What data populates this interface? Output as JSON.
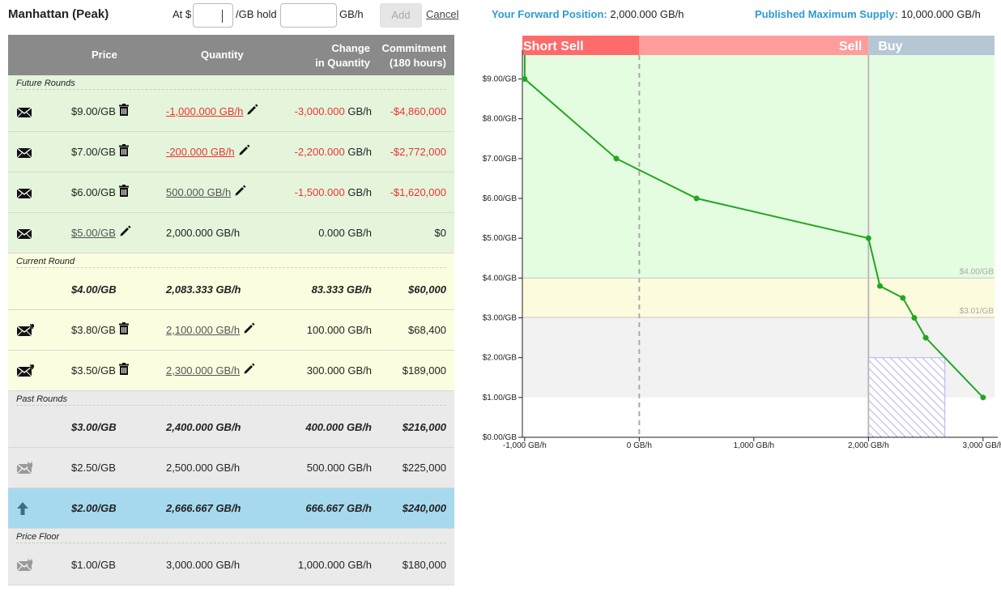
{
  "header": {
    "title": "Manhattan (Peak)",
    "at_label": "At $",
    "price_value": "",
    "gb_hold_label": "/GB hold",
    "hold_value": "",
    "gbh_label": "GB/h",
    "add_label": "Add",
    "cancel_label": "Cancel",
    "forward_position_label": "Your Forward Position:",
    "forward_position_value": "2,000.000 GB/h",
    "max_supply_label": "Published Maximum Supply:",
    "max_supply_value": "10,000.000 GB/h"
  },
  "table": {
    "columns": {
      "price": "Price",
      "quantity": "Quantity",
      "change_1": "Change",
      "change_2": "in Quantity",
      "commitment_1": "Commitment",
      "commitment_2": "(180 hours)"
    },
    "sections": {
      "future": "Future Rounds",
      "current": "Current Round",
      "past": "Past Rounds",
      "floor": "Price Floor"
    },
    "future_rows": [
      {
        "icon": "envelope-icon",
        "price": "$9.00/GB",
        "quantity": "-1,000.000 GB/h",
        "change": "-3,000.000",
        "change_unit": "GB/h",
        "commitment": "-$4,860,000"
      },
      {
        "icon": "envelope-icon",
        "price": "$7.00/GB",
        "quantity": "-200.000 GB/h",
        "change": "-2,200.000",
        "change_unit": "GB/h",
        "commitment": "-$2,772,000"
      },
      {
        "icon": "envelope-icon",
        "price": "$6.00/GB",
        "quantity": "500.000 GB/h",
        "change": "-1,500.000",
        "change_unit": "GB/h",
        "commitment": "-$1,620,000"
      },
      {
        "icon": "envelope-icon",
        "price": "$5.00/GB",
        "quantity": "2,000.000 GB/h",
        "change": "0.000 GB/h",
        "change_unit": "",
        "commitment": "$0"
      }
    ],
    "current_rows": [
      {
        "icon": "",
        "price": "$4.00/GB",
        "quantity": "2,083.333 GB/h",
        "change": "83.333 GB/h",
        "commitment": "$60,000"
      },
      {
        "icon": "envelope-star-icon",
        "price": "$3.80/GB",
        "quantity": "2,100.000 GB/h",
        "change": "100.000 GB/h",
        "commitment": "$68,400"
      },
      {
        "icon": "envelope-star-icon",
        "price": "$3.50/GB",
        "quantity": "2,300.000 GB/h",
        "change": "300.000 GB/h",
        "commitment": "$189,000"
      }
    ],
    "past_rows": [
      {
        "icon": "",
        "price": "$3.00/GB",
        "quantity": "2,400.000 GB/h",
        "change": "400.000 GB/h",
        "commitment": "$216,000"
      },
      {
        "icon": "locked-envelope-icon",
        "price": "$2.50/GB",
        "quantity": "2,500.000 GB/h",
        "change": "500.000 GB/h",
        "commitment": "$225,000"
      },
      {
        "icon": "up-arrow-icon",
        "price": "$2.00/GB",
        "quantity": "2,666.667 GB/h",
        "change": "666.667 GB/h",
        "commitment": "$240,000"
      }
    ],
    "floor_rows": [
      {
        "icon": "locked-envelope-icon",
        "price": "$1.00/GB",
        "quantity": "3,000.000 GB/h",
        "change": "1,000.000 GB/h",
        "commitment": "$180,000"
      }
    ]
  },
  "chart_data": {
    "type": "line",
    "band_labels": {
      "short_sell": "Short Sell",
      "sell": "Sell",
      "buy": "Buy"
    },
    "colors": {
      "short_sell": "#ff6b6b",
      "sell": "#ff9d9d",
      "buy": "#b5c6d4",
      "line": "#22a622",
      "future_region": "#e4fce0",
      "current_region": "#fcfbdd",
      "past_region": "#f2f2f2",
      "hatch": "#b8b0f0"
    },
    "x_ticks": [
      "-1,000 GB/h",
      "0 GB/h",
      "1,000 GB/h",
      "2,000 GB/h",
      "3,000 GB/h"
    ],
    "x_tick_values": [
      -1000,
      0,
      1000,
      2000,
      3000
    ],
    "y_ticks": [
      "$0.00/GB",
      "$1.00/GB",
      "$2.00/GB",
      "$3.00/GB",
      "$4.00/GB",
      "$5.00/GB",
      "$6.00/GB",
      "$7.00/GB",
      "$8.00/GB",
      "$9.00/GB"
    ],
    "y_tick_values": [
      0,
      1,
      2,
      3,
      4,
      5,
      6,
      7,
      8,
      9
    ],
    "xlim": [
      -1020,
      3100
    ],
    "ylim": [
      0,
      9.6
    ],
    "reference_lines": [
      {
        "y": 4.0,
        "label": "$4.00/GB"
      },
      {
        "y": 3.01,
        "label": "$3.01/GB"
      }
    ],
    "series": [
      {
        "x": [
          -1000,
          -1000,
          -200,
          500,
          2000,
          2100,
          2300,
          2400,
          2500,
          3000
        ],
        "y": [
          9.6,
          9.0,
          7.0,
          6.0,
          5.0,
          3.8,
          3.5,
          3.0,
          2.5,
          1.0
        ],
        "markers": [
          false,
          true,
          true,
          true,
          true,
          true,
          true,
          true,
          true,
          true
        ]
      }
    ],
    "position_x": 2000,
    "zero_x": 0,
    "hatch_box": {
      "x0": 2000,
      "x1": 2666.667,
      "y0": 0,
      "y1": 2.0
    }
  }
}
